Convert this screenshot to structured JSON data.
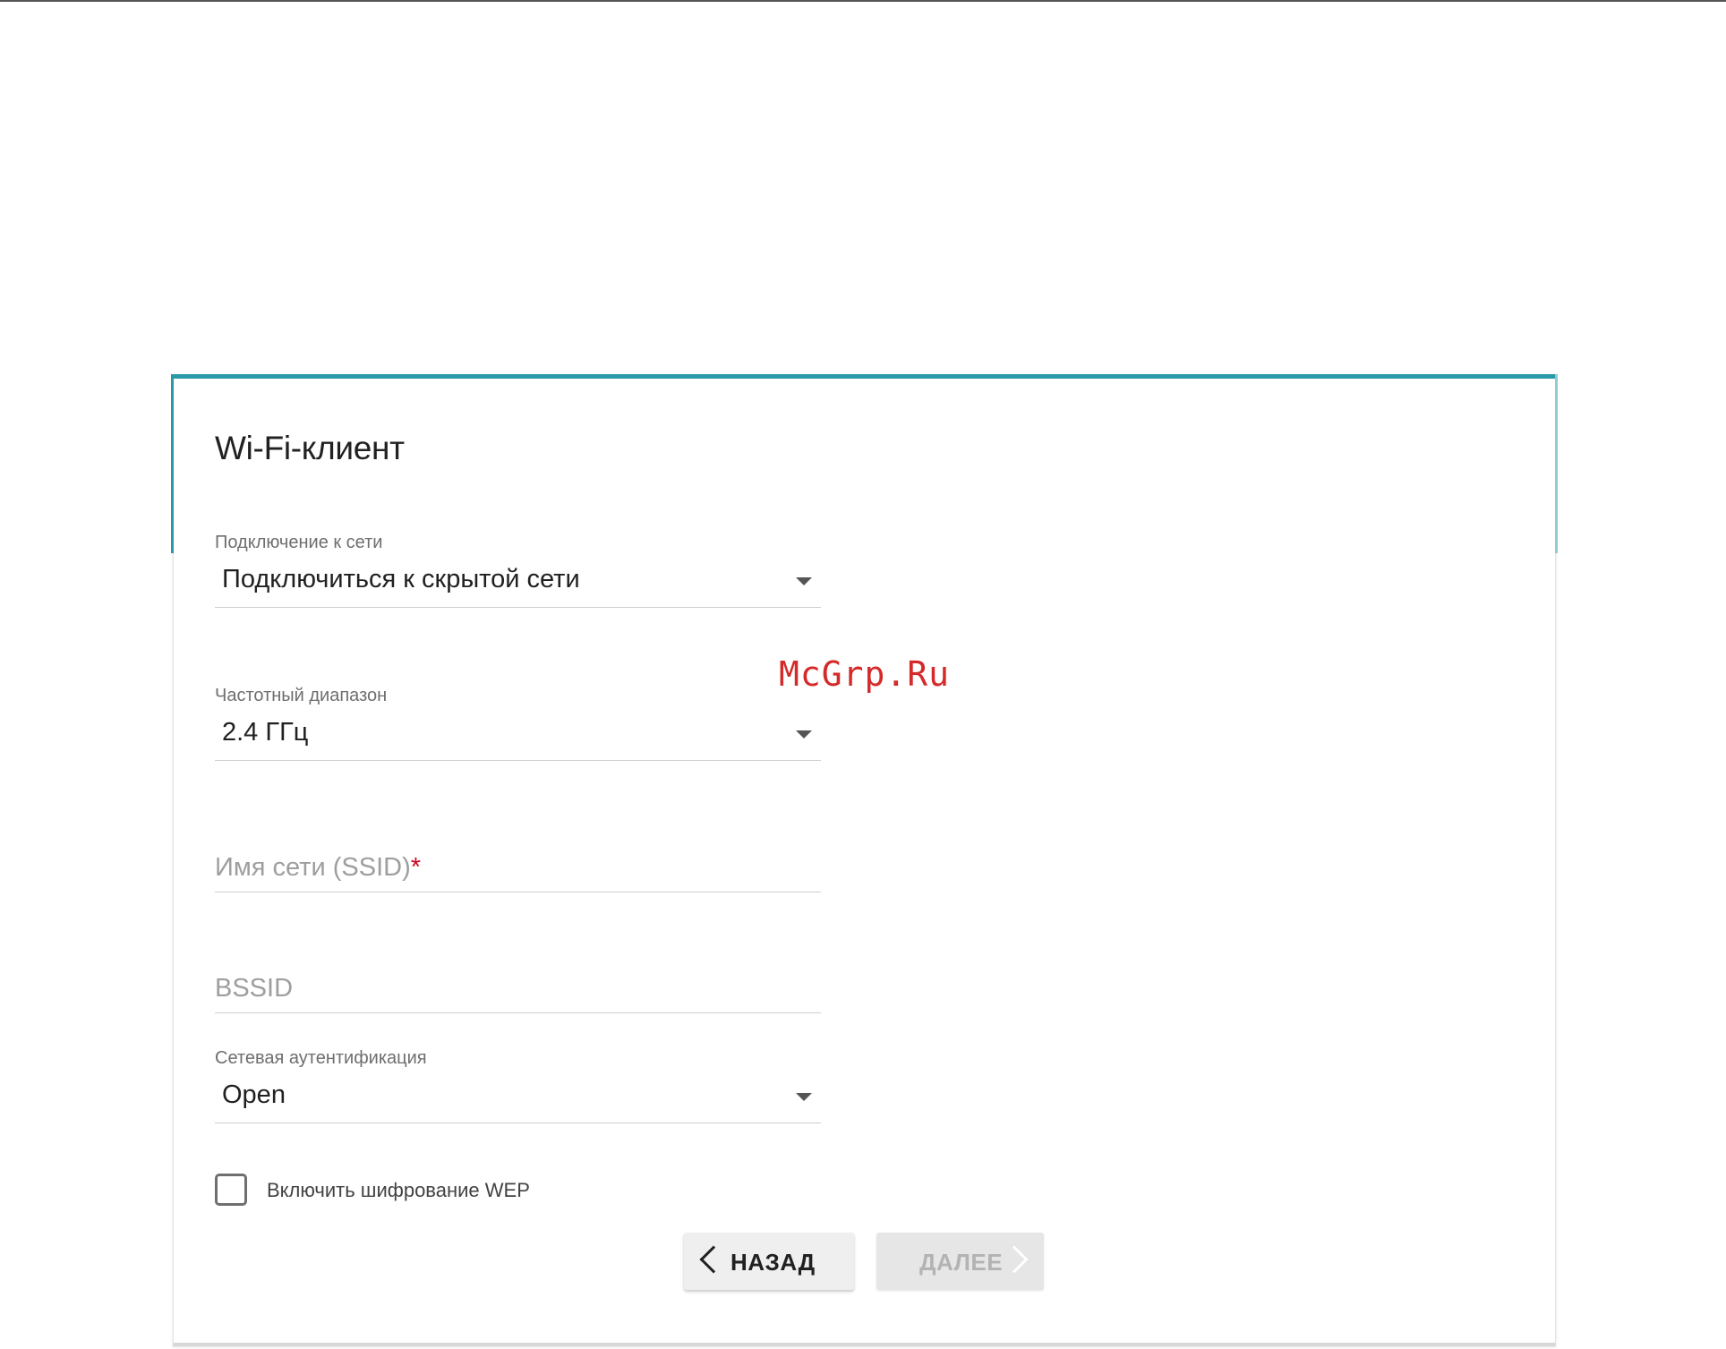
{
  "card": {
    "title": "Wi-Fi-клиент"
  },
  "form": {
    "connection": {
      "label": "Подключение к сети",
      "value": "Подключиться к скрытой сети"
    },
    "band": {
      "label": "Частотный диапазон",
      "value": "2.4 ГГц"
    },
    "ssid": {
      "placeholder": "Имя сети (SSID)",
      "required_mark": "*",
      "value": ""
    },
    "bssid": {
      "placeholder": "BSSID",
      "value": ""
    },
    "auth": {
      "label": "Сетевая аутентификация",
      "value": "Open"
    },
    "wep": {
      "label": "Включить шифрование WEP",
      "checked": false
    }
  },
  "buttons": {
    "back_label": "НАЗАД",
    "next_label": "ДАЛЕЕ",
    "next_enabled": false
  },
  "watermark": "McGrp.Ru",
  "colors": {
    "accent": "#2a9aa8",
    "required": "#d0021b",
    "watermark": "#d42a2a"
  },
  "icons": {
    "dropdown": "caret-down-icon",
    "back": "chevron-left-icon",
    "next": "chevron-right-icon"
  }
}
